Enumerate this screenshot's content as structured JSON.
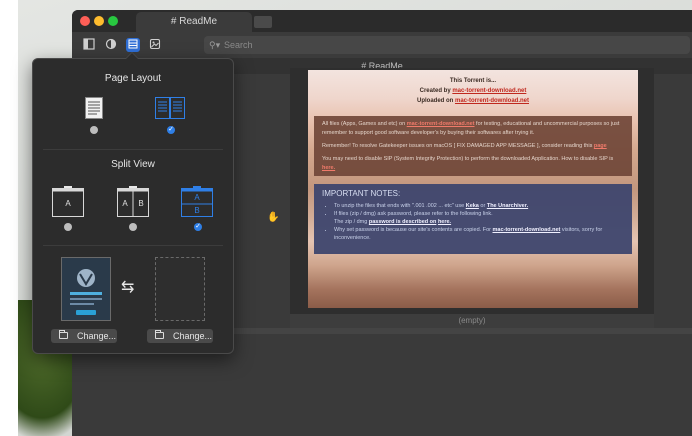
{
  "window": {
    "tab_title": "# ReadMe",
    "doc_title": "# ReadMe",
    "search_placeholder": "Search",
    "empty_label": "(empty)"
  },
  "document": {
    "intro_line1": "This Torrent is...",
    "intro_created_prefix": "Created by ",
    "intro_created_link": "mac-torrent-download.net",
    "intro_uploaded_prefix": "Uploaded on ",
    "intro_uploaded_link": "mac-torrent-download.net",
    "para1_prefix": "All files (Apps, Games and etc) on ",
    "para1_link": "mac-torrent-download.net",
    "para1_suffix": " for testing, educational and uncommercial purposes so just remember to support good software developer's by buying their softwares after trying it.",
    "para2_prefix": "Remember! To resolve Gatekeeper issues on macOS [ FIX DAMAGED APP MESSAGE ], consider reading this ",
    "para2_link": "page",
    "para3_prefix": "You may need to disable SIP (System Integrity Protection) to perform the downloaded Application. How to disable SIP is ",
    "para3_link": "here.",
    "notes_heading": "IMPORTANT NOTES:",
    "note1_prefix": "To unzip the files that ends with \".001 .002 ... etc\" use ",
    "note1_link1": "Keka",
    "note1_mid": " or ",
    "note1_link2": "The Unarchiver.",
    "note2_prefix": "If files (zip / dmg) ask password, please refer to the following link.",
    "note2_sub_prefix": "The zip / dmg ",
    "note2_sub_link1": "password is described on",
    "note2_sub_link2": "here.",
    "note3_prefix": "Why set password is because our site's contents are copied. For ",
    "note3_link": "mac-torrent-download.net",
    "note3_suffix": " visitors, sorry for inconvenience."
  },
  "popover": {
    "page_layout_title": "Page Layout",
    "split_view_title": "Split View",
    "split_single_label": "A",
    "split_side_a": "A",
    "split_side_b": "B",
    "split_stack_a": "A",
    "split_stack_b": "B",
    "change_left_label": "Change...",
    "change_right_label": "Change...",
    "selected_page_layout": "two-page",
    "selected_split_view": "stacked"
  },
  "colors": {
    "accent": "#2f7fe6",
    "popover_bg": "#2c2c2c",
    "window_bg": "#3a3a3a",
    "link_red": "#c0281e"
  },
  "icons": {
    "sidebar_toggle": "sidebar-icon",
    "appearance": "appearance-icon",
    "layout": "layout-icon",
    "export": "export-icon",
    "search": "magnifier-icon",
    "swap": "swap-arrows-icon",
    "folder": "folder-icon",
    "cursor": "hand-cursor-icon"
  }
}
